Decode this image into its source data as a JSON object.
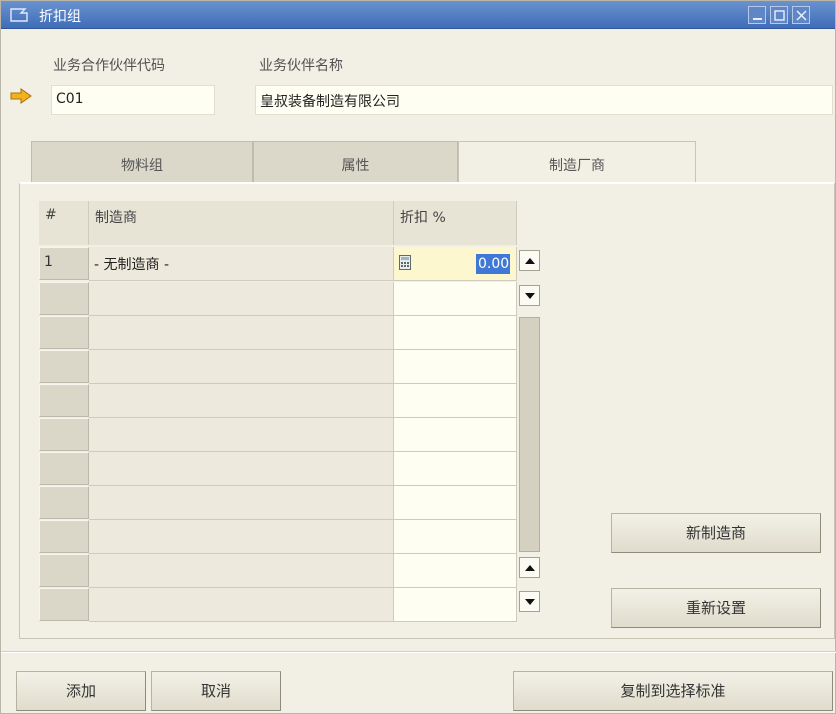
{
  "window": {
    "title": "折扣组",
    "controls": [
      "minimize-icon",
      "maximize-icon",
      "close-icon"
    ],
    "accent_color": "#3f6db8"
  },
  "header": {
    "bp_code_label": "业务合作伙伴代码",
    "bp_code_value": "C01",
    "bp_name_label": "业务伙伴名称",
    "bp_name_value": "皇叔装备制造有限公司"
  },
  "tabs": [
    {
      "label": "物料组",
      "active": false
    },
    {
      "label": "属性",
      "active": false
    },
    {
      "label": "制造厂商",
      "active": true
    }
  ],
  "table": {
    "columns": [
      "#",
      "制造商",
      "折扣 %"
    ],
    "rows": [
      {
        "num": "1",
        "manufacturer": "- 无制造商 -",
        "discount": "0.00"
      },
      {
        "num": "",
        "manufacturer": "",
        "discount": ""
      },
      {
        "num": "",
        "manufacturer": "",
        "discount": ""
      },
      {
        "num": "",
        "manufacturer": "",
        "discount": ""
      },
      {
        "num": "",
        "manufacturer": "",
        "discount": ""
      },
      {
        "num": "",
        "manufacturer": "",
        "discount": ""
      },
      {
        "num": "",
        "manufacturer": "",
        "discount": ""
      },
      {
        "num": "",
        "manufacturer": "",
        "discount": ""
      },
      {
        "num": "",
        "manufacturer": "",
        "discount": ""
      },
      {
        "num": "",
        "manufacturer": "",
        "discount": ""
      },
      {
        "num": "",
        "manufacturer": "",
        "discount": ""
      }
    ]
  },
  "side_buttons": {
    "new_manufacturer": "新制造商",
    "reset": "重新设置"
  },
  "footer": {
    "add": "添加",
    "cancel": "取消",
    "copy_to_selection": "复制到选择标准"
  }
}
